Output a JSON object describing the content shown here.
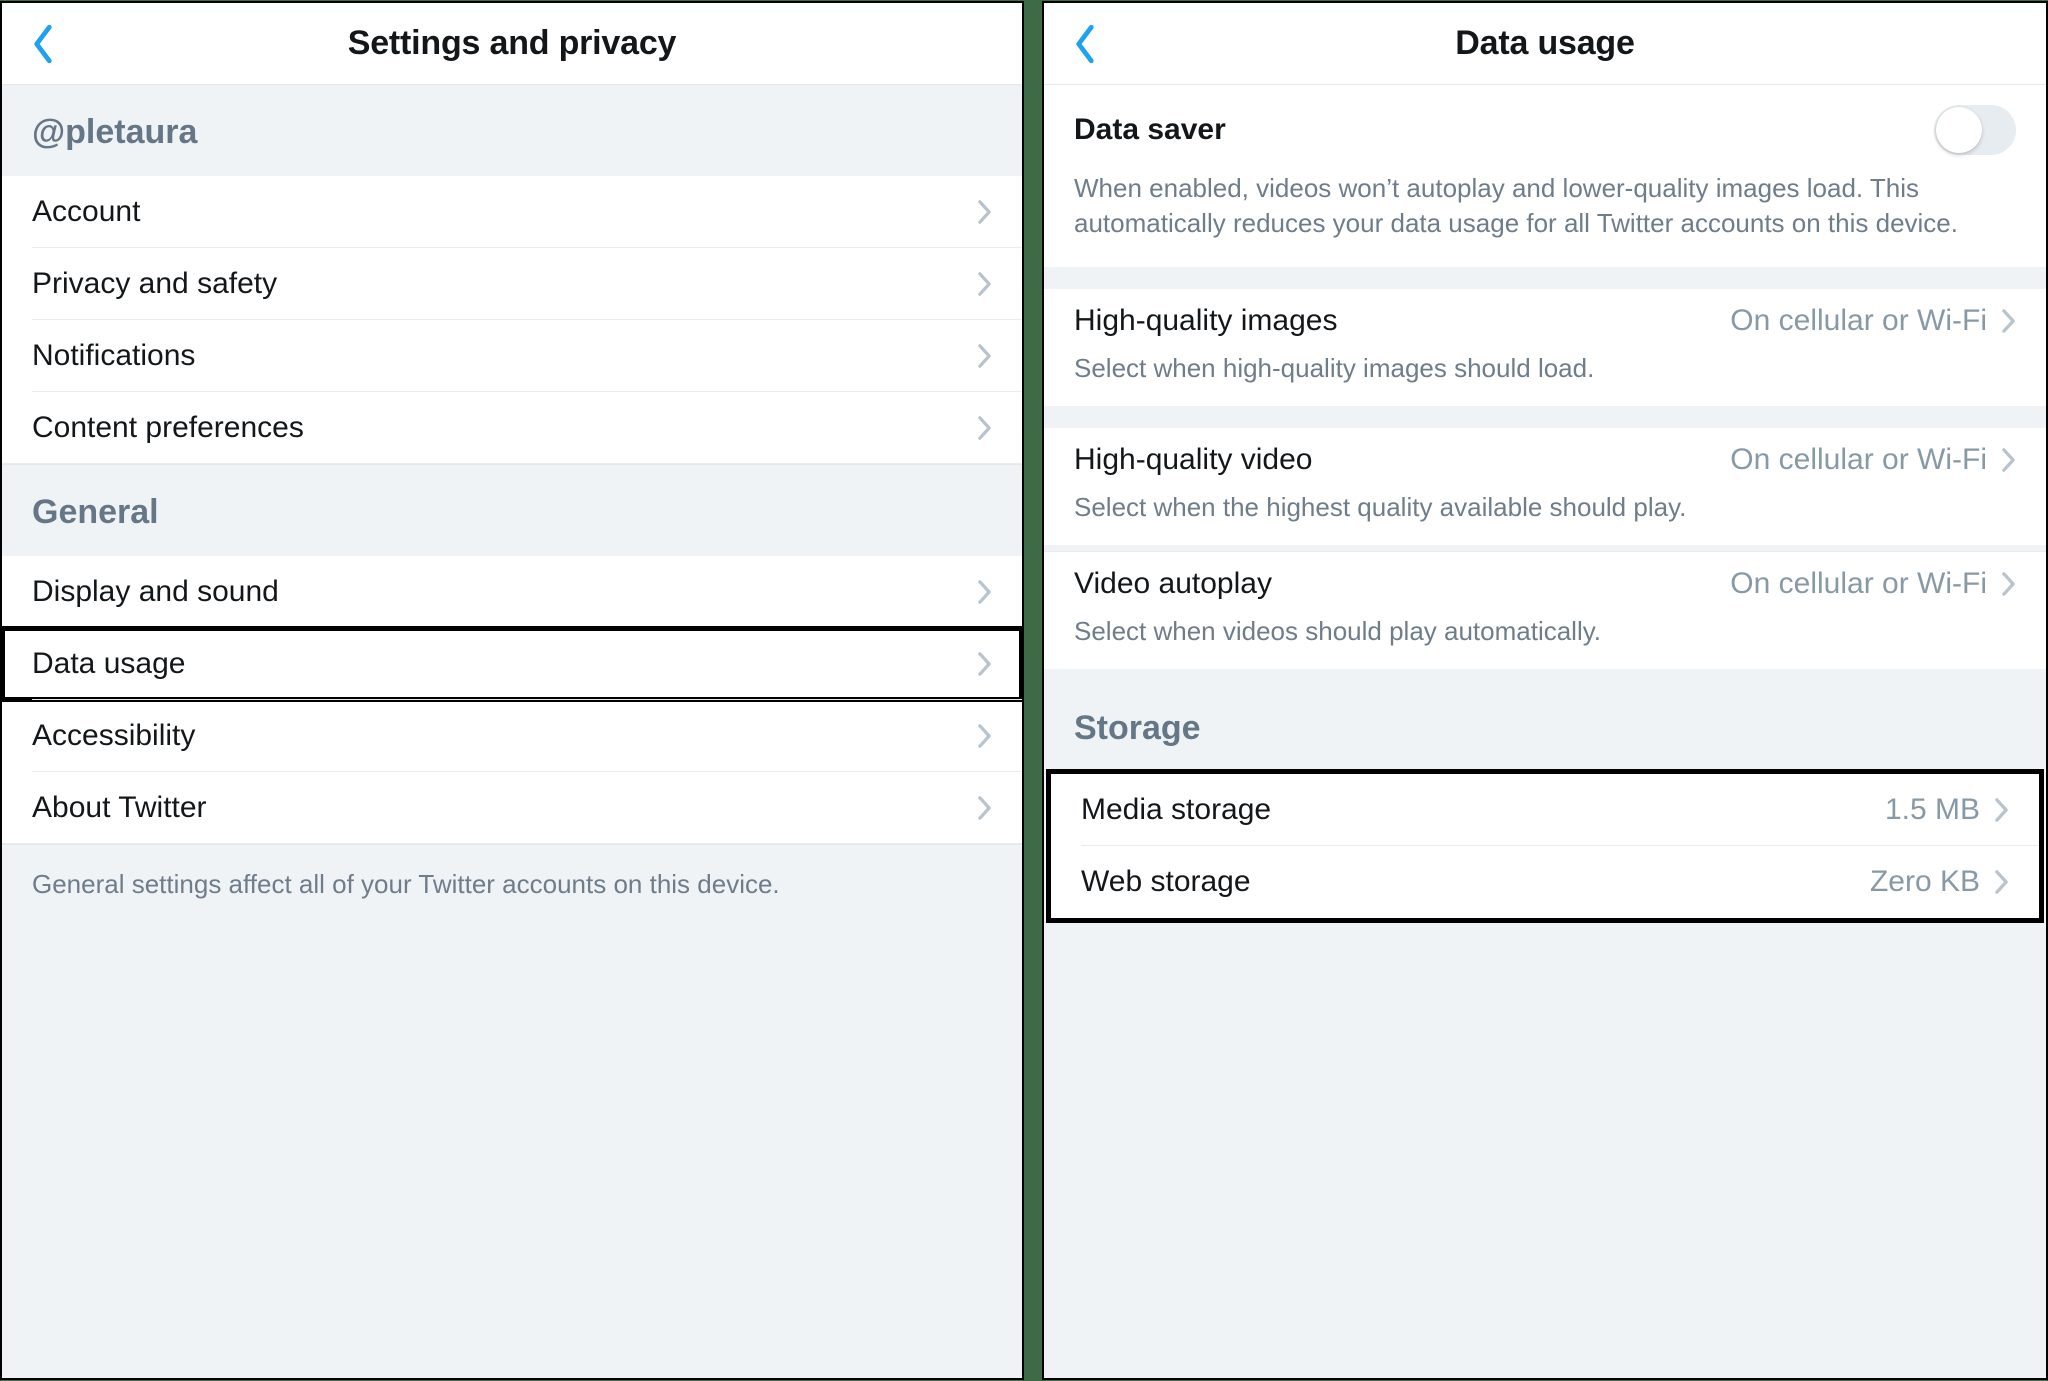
{
  "left": {
    "title": "Settings and privacy",
    "user_handle": "@pletaura",
    "items_account": [
      {
        "label": "Account"
      },
      {
        "label": "Privacy and safety"
      },
      {
        "label": "Notifications"
      },
      {
        "label": "Content preferences"
      }
    ],
    "general_header": "General",
    "items_general": [
      {
        "label": "Display and sound"
      },
      {
        "label": "Data usage",
        "highlight": true
      },
      {
        "label": "Accessibility"
      },
      {
        "label": "About Twitter"
      }
    ],
    "footer": "General settings affect all of your Twitter accounts on this device."
  },
  "right": {
    "title": "Data usage",
    "data_saver": {
      "label": "Data saver",
      "enabled": false,
      "note": "When enabled, videos won’t autoplay and lower-quality images load. This automatically reduces your data usage for all Twitter accounts on this device."
    },
    "rows": [
      {
        "label": "High-quality images",
        "value": "On cellular or Wi-Fi",
        "note": "Select when high-quality images should load."
      },
      {
        "label": "High-quality video",
        "value": "On cellular or Wi-Fi",
        "note": "Select when the highest quality available should play."
      },
      {
        "label": "Video autoplay",
        "value": "On cellular or Wi-Fi",
        "note": "Select when videos should play automatically."
      }
    ],
    "storage_header": "Storage",
    "storage": [
      {
        "label": "Media storage",
        "value": "1.5 MB"
      },
      {
        "label": "Web storage",
        "value": "Zero KB"
      }
    ]
  }
}
